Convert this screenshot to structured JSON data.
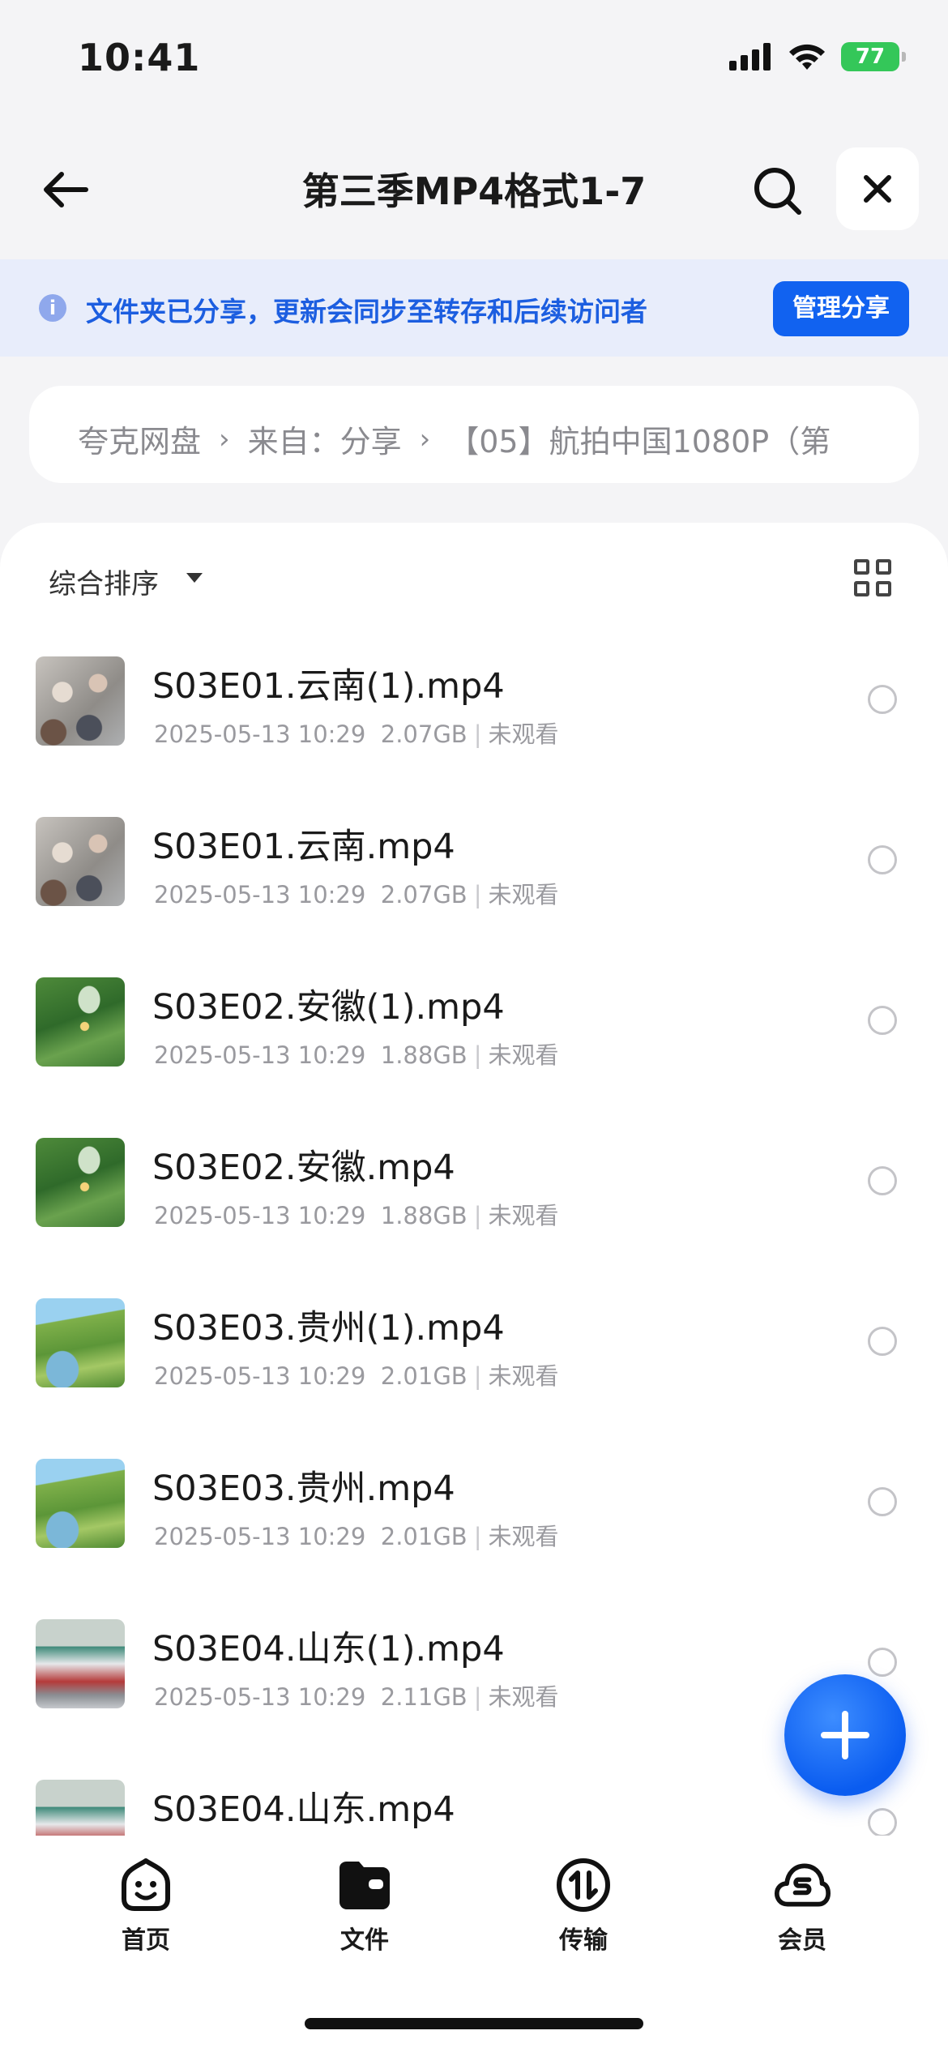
{
  "status_bar": {
    "time": "10:41",
    "battery": "77"
  },
  "nav": {
    "title": "第三季MP4格式1-7"
  },
  "banner": {
    "text": "文件夹已分享，更新会同步至转存和后续访问者",
    "button": "管理分享"
  },
  "breadcrumb": [
    "夸克网盘",
    "来自：分享",
    "【05】航拍中国1080P（第"
  ],
  "sort": {
    "label": "综合排序"
  },
  "files": [
    {
      "name": "S03E01.云南(1).mp4",
      "date": "2025-05-13 10:29",
      "size": "2.07GB",
      "status": "未观看",
      "thumb": "yunnan"
    },
    {
      "name": "S03E01.云南.mp4",
      "date": "2025-05-13 10:29",
      "size": "2.07GB",
      "status": "未观看",
      "thumb": "yunnan"
    },
    {
      "name": "S03E02.安徽(1).mp4",
      "date": "2025-05-13 10:29",
      "size": "1.88GB",
      "status": "未观看",
      "thumb": "anhui"
    },
    {
      "name": "S03E02.安徽.mp4",
      "date": "2025-05-13 10:29",
      "size": "1.88GB",
      "status": "未观看",
      "thumb": "anhui"
    },
    {
      "name": "S03E03.贵州(1).mp4",
      "date": "2025-05-13 10:29",
      "size": "2.01GB",
      "status": "未观看",
      "thumb": "guizhou"
    },
    {
      "name": "S03E03.贵州.mp4",
      "date": "2025-05-13 10:29",
      "size": "2.01GB",
      "status": "未观看",
      "thumb": "guizhou"
    },
    {
      "name": "S03E04.山东(1).mp4",
      "date": "2025-05-13 10:29",
      "size": "2.11GB",
      "status": "未观看",
      "thumb": "shandong"
    },
    {
      "name": "S03E04.山东.mp4",
      "date": "",
      "size": "",
      "status": "",
      "thumb": "shandong"
    }
  ],
  "tabs": [
    {
      "label": "首页",
      "icon": "smiley-home-icon"
    },
    {
      "label": "文件",
      "icon": "folder-icon"
    },
    {
      "label": "传输",
      "icon": "transfer-icon"
    },
    {
      "label": "会员",
      "icon": "member-cloud-icon"
    }
  ],
  "colors": {
    "accent": "#1162f0",
    "banner_bg": "#e8edfb",
    "banner_text": "#1c5ee0"
  }
}
